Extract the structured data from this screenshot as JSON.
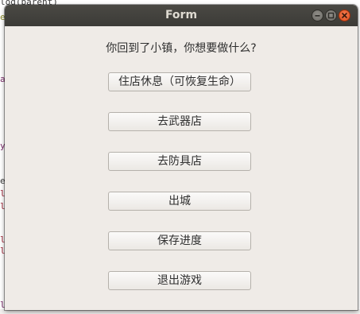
{
  "background_code": {
    "top_fragment": "log(parent)",
    "left_fragments": [
      "e",
      "a",
      "y",
      "e",
      "l",
      "l",
      "l",
      "l",
      "l"
    ]
  },
  "window": {
    "title": "Form",
    "controls": [
      "minimize-icon",
      "maximize-icon",
      "close-icon"
    ]
  },
  "prompt": "你回到了小镇，你想要做什么?",
  "buttons": [
    {
      "label": "住店休息（可恢复生命）"
    },
    {
      "label": "去武器店"
    },
    {
      "label": "去防具店"
    },
    {
      "label": "出城"
    },
    {
      "label": "保存进度"
    },
    {
      "label": "退出游戏"
    }
  ],
  "colors": {
    "titlebar": "#3c3b37",
    "window_bg": "#efebe7",
    "close_button": "#e95420"
  }
}
